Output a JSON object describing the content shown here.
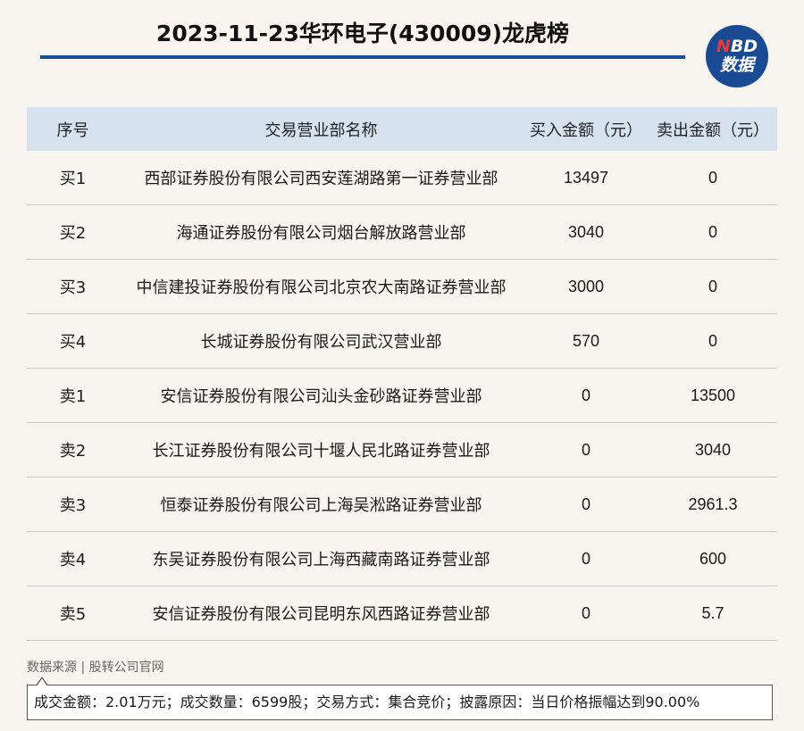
{
  "title": "2023-11-23华环电子(430009)龙虎榜",
  "logo": {
    "top_n": "N",
    "top_rest": "BD",
    "bottom": "数据"
  },
  "table": {
    "headers": [
      "序号",
      "交易营业部名称",
      "买入金额（元）",
      "卖出金额（元）"
    ],
    "rows": [
      [
        "买1",
        "西部证券股份有限公司西安莲湖路第一证券营业部",
        "13497",
        "0"
      ],
      [
        "买2",
        "海通证券股份有限公司烟台解放路营业部",
        "3040",
        "0"
      ],
      [
        "买3",
        "中信建投证券股份有限公司北京农大南路证券营业部",
        "3000",
        "0"
      ],
      [
        "买4",
        "长城证券股份有限公司武汉营业部",
        "570",
        "0"
      ],
      [
        "卖1",
        "安信证券股份有限公司汕头金砂路证券营业部",
        "0",
        "13500"
      ],
      [
        "卖2",
        "长江证券股份有限公司十堰人民北路证券营业部",
        "0",
        "3040"
      ],
      [
        "卖3",
        "恒泰证券股份有限公司上海吴淞路证券营业部",
        "0",
        "2961.3"
      ],
      [
        "卖4",
        "东吴证券股份有限公司上海西藏南路证券营业部",
        "0",
        "600"
      ],
      [
        "卖5",
        "安信证券股份有限公司昆明东风西路证券营业部",
        "0",
        "5.7"
      ]
    ]
  },
  "source": "数据来源 | 股转公司官网",
  "note": "成交金额：2.01万元；成交数量：6599股；交易方式：集合竞价；披露原因：当日价格振幅达到90.00%"
}
